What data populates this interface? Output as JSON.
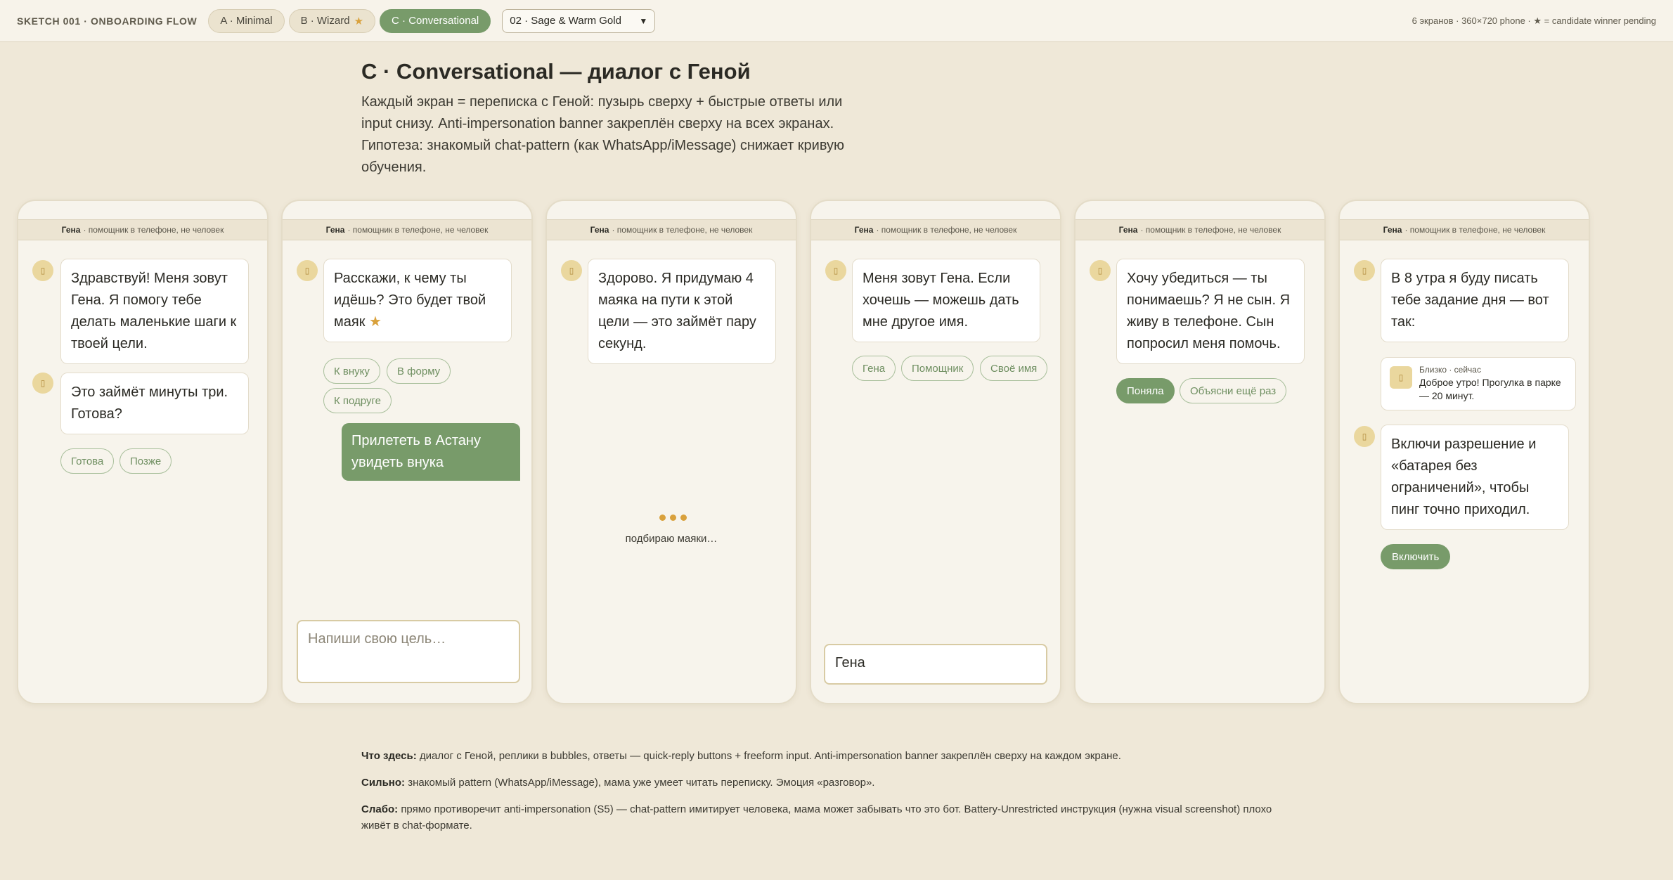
{
  "topbar": {
    "brand": "SKETCH 001 · ONBOARDING FLOW",
    "tabs": [
      {
        "label": "A · Minimal",
        "star": ""
      },
      {
        "label": "B · Wizard",
        "star": "★"
      },
      {
        "label": "C · Conversational",
        "star": ""
      }
    ],
    "active_tab": "C · Conversational",
    "theme_select": {
      "value": "02 · Sage & Warm Gold"
    },
    "meta": "6 экранов · 360×720 phone · ★ = candidate winner pending"
  },
  "header": {
    "title": "C · Conversational — диалог с Геной",
    "description": "Каждый экран = переписка с Геной: пузырь сверху + быстрые ответы или input снизу. Anti-impersonation banner закреплён сверху на всех экранах. Гипотеза: знакомый chat-pattern (как WhatsApp/iMessage) снижает кривую обучения."
  },
  "banner": {
    "name": "Гена",
    "text": "· помощник в телефоне, не человек"
  },
  "avatar_glyph": "▯",
  "screens": {
    "s1": {
      "bubble1": "Здравствуй! Меня зовут Гена. Я помогу тебе делать маленькие шаги к твоей цели.",
      "bubble2": "Это займёт минуты три. Готова?",
      "replies": [
        "Готова",
        "Позже"
      ]
    },
    "s2": {
      "bubble": "Расскажи, к чему ты идёшь? Это будет твой маяк",
      "star": "★",
      "replies": [
        "К внуку",
        "В форму",
        "К подруге"
      ],
      "user_message": "Прилететь в Астану увидеть внука",
      "input_placeholder": "Напиши свою цель…"
    },
    "s3": {
      "bubble": "Здорово. Я придумаю 4 маяка на пути к этой цели — это займёт пару секунд.",
      "typing_label": "подбираю маяки…"
    },
    "s4": {
      "bubble": "Меня зовут Гена. Если хочешь — можешь дать мне другое имя.",
      "replies": [
        "Гена",
        "Помощник",
        "Своё имя"
      ],
      "input_value": "Гена"
    },
    "s5": {
      "bubble": "Хочу убедиться — ты понимаешь? Я не сын. Я живу в телефоне. Сын попросил меня помочь.",
      "reply_primary": "Поняла",
      "reply_secondary": "Объясни ещё раз"
    },
    "s6": {
      "bubble1": "В 8 утра я буду писать тебе задание дня — вот так:",
      "notif_meta": "Близко · сейчас",
      "notif_text": "Доброе утро! Прогулка в парке — 20 минут.",
      "bubble2": "Включи разрешение и «батарея без ограничений», чтобы пинг точно приходил.",
      "button": "Включить"
    }
  },
  "notes": {
    "what_label": "Что здесь:",
    "what_text": "диалог с Геной, реплики в bubbles, ответы — quick-reply buttons + freeform input. Anti-impersonation banner закреплён сверху на каждом экране.",
    "strong_label": "Сильно:",
    "strong_text": "знакомый pattern (WhatsApp/iMessage), мама уже умеет читать переписку. Эмоция «разговор».",
    "weak_label": "Слабо:",
    "weak_text": "прямо противоречит anti-impersonation (S5) — chat-pattern имитирует человека, мама может забывать что это бот. Battery-Unrestricted инструкция (нужна visual screenshot) плохо живёт в chat-формате."
  }
}
